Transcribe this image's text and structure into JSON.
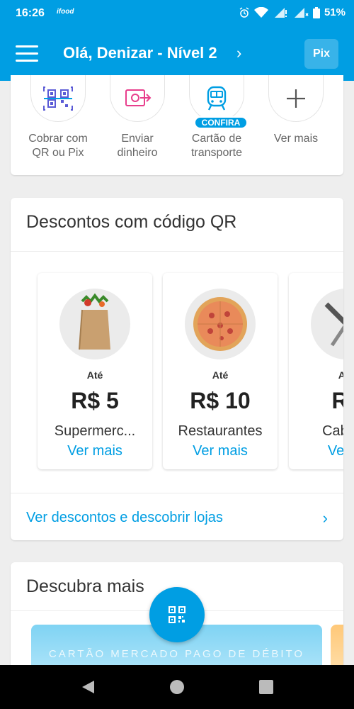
{
  "status_bar": {
    "time": "16:26",
    "app_badge": "ifood",
    "battery": "51%"
  },
  "header": {
    "greeting": "Olá, Denizar - Nível 2",
    "chevron": "›",
    "pix_label": "Pix",
    "background_color": "#009ee3"
  },
  "quick_actions": [
    {
      "label_line1": "Cobrar com",
      "label_line2": "QR ou Pix",
      "icon": "qr-code-icon"
    },
    {
      "label_line1": "Enviar",
      "label_line2": "dinheiro",
      "icon": "send-money-icon"
    },
    {
      "label_line1": "Cartão de",
      "label_line2": "transporte",
      "icon": "transport-card-icon",
      "badge": "CONFIRA"
    },
    {
      "label_line1": "Ver mais",
      "label_line2": "",
      "icon": "plus-icon"
    }
  ],
  "discounts": {
    "title": "Descontos com código QR",
    "items": [
      {
        "prefix": "Até",
        "value": "R$ 5",
        "name": "Supermerc...",
        "more": "Ver mais",
        "icon": "grocery-bag-icon"
      },
      {
        "prefix": "Até",
        "value": "R$ 10",
        "name": "Restaurantes",
        "more": "Ver mais",
        "icon": "pizza-icon"
      },
      {
        "prefix": "Até",
        "value": "R$",
        "name": "Cabelei",
        "more": "Ver m",
        "icon": "scissors-comb-icon"
      }
    ],
    "link_text": "Ver descontos e descobrir lojas",
    "link_chevron": "›"
  },
  "discover": {
    "title": "Descubra mais",
    "banner_text": "CARTÃO MERCADO PAGO DE DÉBITO"
  },
  "accent_color": "#009ee3"
}
